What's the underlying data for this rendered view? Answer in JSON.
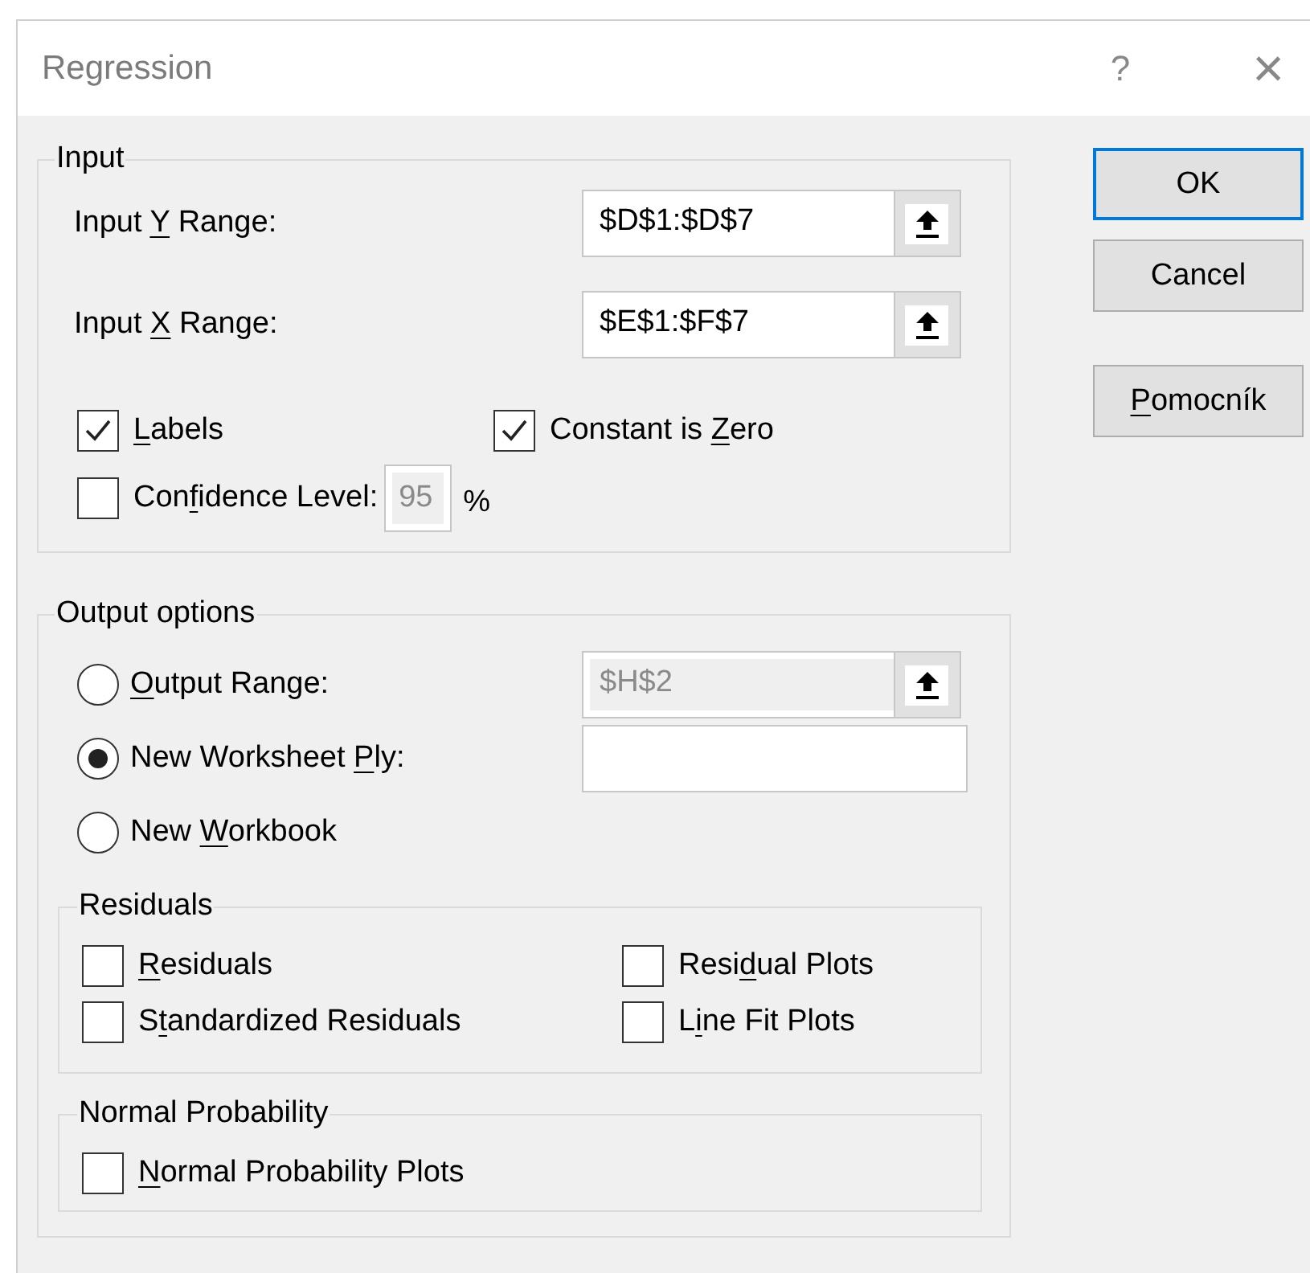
{
  "window": {
    "title": "Regression",
    "help_button": "?",
    "close_button": "×"
  },
  "input": {
    "legend": "Input",
    "ranges": [
      {
        "label": [
          {
            "text": "Input ",
            "underlined": false
          },
          {
            "text": "Y",
            "underlined": true
          },
          {
            "text": " Range:",
            "underlined": false
          }
        ],
        "value": "$D$1:$D$7"
      },
      {
        "label": [
          {
            "text": "Input ",
            "underlined": false
          },
          {
            "text": "X",
            "underlined": true
          },
          {
            "text": " Range:",
            "underlined": false
          }
        ],
        "value": "$E$1:$F$7"
      }
    ],
    "option_rows": [
      [
        {
          "kind": "checkbox",
          "checked": true,
          "label": [
            {
              "text": "L",
              "underlined": true
            },
            {
              "text": "abels",
              "underlined": false
            }
          ]
        },
        {
          "kind": "checkbox",
          "checked": true,
          "label": [
            {
              "text": "Constant is ",
              "underlined": false
            },
            {
              "text": "Z",
              "underlined": true
            },
            {
              "text": "ero",
              "underlined": false
            }
          ]
        }
      ],
      [
        {
          "kind": "checkbox_field",
          "checked": false,
          "label": [
            {
              "text": "Con",
              "underlined": false
            },
            {
              "text": "f",
              "underlined": true
            },
            {
              "text": "idence Level:",
              "underlined": false
            }
          ],
          "value": "95",
          "disabled": true,
          "unit": "%"
        }
      ]
    ]
  },
  "output": {
    "legend": "Output options",
    "destinations": [
      {
        "selected": false,
        "label": [
          {
            "text": "O",
            "underlined": true
          },
          {
            "text": "utput Range:",
            "underlined": false
          }
        ],
        "field": {
          "value": "$H$2",
          "disabled": true,
          "picker": true
        }
      },
      {
        "selected": true,
        "label": [
          {
            "text": "New Worksheet ",
            "underlined": false
          },
          {
            "text": "P",
            "underlined": true
          },
          {
            "text": "ly:",
            "underlined": false
          }
        ],
        "field": {
          "disabled": false,
          "picker": false
        }
      },
      {
        "selected": false,
        "label": [
          {
            "text": "New ",
            "underlined": false
          },
          {
            "text": "W",
            "underlined": true
          },
          {
            "text": "orkbook",
            "underlined": false
          }
        ]
      }
    ],
    "groups": [
      {
        "legend": "Residuals",
        "rows": [
          [
            {
              "checked": false,
              "label": [
                {
                  "text": "R",
                  "underlined": true
                },
                {
                  "text": "esiduals",
                  "underlined": false
                }
              ]
            },
            {
              "checked": false,
              "label": [
                {
                  "text": "Resi",
                  "underlined": false
                },
                {
                  "text": "d",
                  "underlined": true
                },
                {
                  "text": "ual Plots",
                  "underlined": false
                }
              ]
            }
          ],
          [
            {
              "checked": false,
              "label": [
                {
                  "text": "S",
                  "underlined": false
                },
                {
                  "text": "t",
                  "underlined": true
                },
                {
                  "text": "andardized Residuals",
                  "underlined": false
                }
              ]
            },
            {
              "checked": false,
              "label": [
                {
                  "text": "L",
                  "underlined": false
                },
                {
                  "text": "i",
                  "underlined": true
                },
                {
                  "text": "ne Fit Plots",
                  "underlined": false
                }
              ]
            }
          ]
        ]
      },
      {
        "legend": "Normal Probability",
        "rows": [
          [
            {
              "checked": false,
              "label": [
                {
                  "text": "N",
                  "underlined": true
                },
                {
                  "text": "ormal Probability Plots",
                  "underlined": false
                }
              ]
            }
          ]
        ]
      }
    ]
  },
  "buttons": [
    {
      "default": true,
      "label": [
        {
          "text": "OK",
          "underlined": false
        }
      ]
    },
    {
      "default": false,
      "label": [
        {
          "text": "Cancel",
          "underlined": false
        }
      ]
    },
    {
      "default": false,
      "label": [
        {
          "text": "P",
          "underlined": true
        },
        {
          "text": "omocník",
          "underlined": false
        }
      ]
    }
  ]
}
